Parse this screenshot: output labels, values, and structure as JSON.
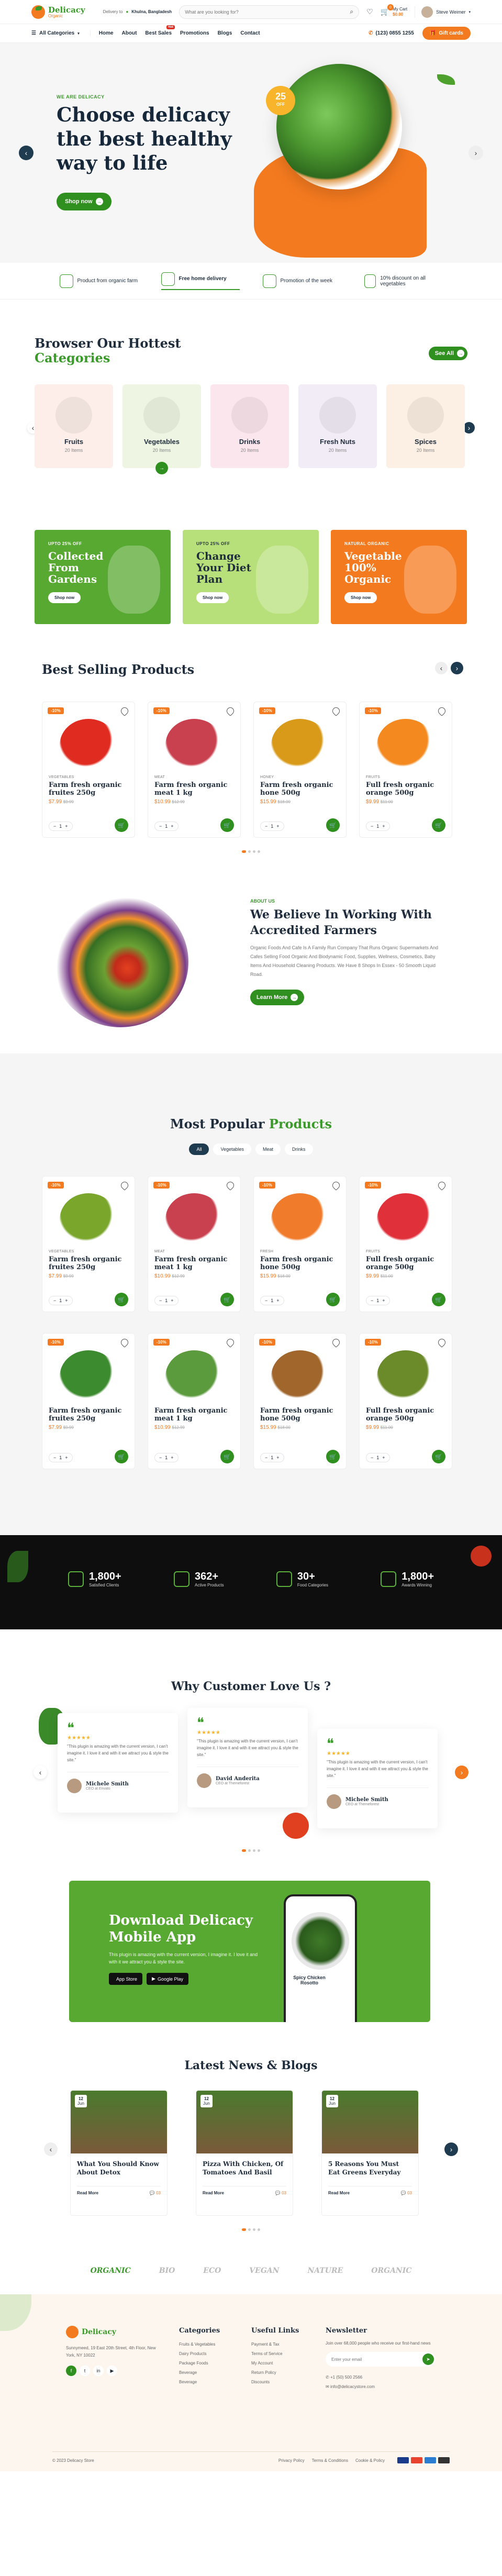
{
  "header": {
    "brand": "Delicacy",
    "brand_sub": "Organic",
    "deliver_label": "Delivery to",
    "location": "Khulna, Bangladesh",
    "search_placeholder": "What are you looking for?",
    "cart_label": "My Cart",
    "cart_amount": "$0.00",
    "cart_count": "0",
    "user": "Steve Weimer",
    "all_categories": "All Categories",
    "nav": [
      "Home",
      "About",
      "Best Sales",
      "Promotions",
      "Blogs",
      "Contact"
    ],
    "hot_badge": "Hot",
    "phone": "(123) 0855 1255",
    "gift_btn": "Gift cards"
  },
  "hero": {
    "kicker": "WE ARE DELICACY",
    "title": "Choose delicacy the best healthy way to life",
    "button": "Shop now",
    "discount_pct": "25",
    "discount_label": "OFF"
  },
  "features": [
    {
      "label": "Product from organic farm"
    },
    {
      "label": "Free home delivery"
    },
    {
      "label": "Promotion of the week"
    },
    {
      "label": "10% discount on all vegetables"
    }
  ],
  "categories": {
    "title_a": "Browser Our Hottest",
    "title_b": "Categories",
    "see_all": "See All",
    "items": [
      {
        "name": "Fruits",
        "count": "20 Items",
        "bg": "#fdeee9"
      },
      {
        "name": "Vegetables",
        "count": "20 Items",
        "bg": "#eef6e3"
      },
      {
        "name": "Drinks",
        "count": "20 Items",
        "bg": "#fce6ee"
      },
      {
        "name": "Fresh Nuts",
        "count": "20 Items",
        "bg": "#f2ecf7"
      },
      {
        "name": "Spices",
        "count": "20 Items",
        "bg": "#fcefe3"
      }
    ]
  },
  "promos": [
    {
      "tag": "UPTO 25% OFF",
      "title": "Collected From Gardens",
      "button": "Shop now",
      "bg": "#57a931"
    },
    {
      "tag": "UPTO 25% OFF",
      "title": "Change Your Diet Plan",
      "button": "Shop now",
      "bg": "#b8e07a"
    },
    {
      "tag": "NATURAL ORGANIC",
      "title": "Vegetable 100% Organic",
      "button": "Shop now",
      "bg": "#f47a1f"
    }
  ],
  "best_selling": {
    "title": "Best Selling Products",
    "items": [
      {
        "cat": "VEGETABLES",
        "name": "Farm fresh organic fruites 250g",
        "price": "$7.99",
        "old": "$9.99",
        "badge": "-10%",
        "qty": "1",
        "color": "#e02b20"
      },
      {
        "cat": "MEAT",
        "name": "Farm fresh organic meat 1 kg",
        "price": "$10.99",
        "old": "$12.99",
        "badge": "-10%",
        "qty": "1",
        "color": "#c9404f"
      },
      {
        "cat": "HONEY",
        "name": "Farm fresh organic hone 500g",
        "price": "$15.99",
        "old": "$18.00",
        "badge": "-10%",
        "qty": "1",
        "color": "#d89a18"
      },
      {
        "cat": "FRUITS",
        "name": "Full fresh organic orange 500g",
        "price": "$9.99",
        "old": "$11.00",
        "badge": "-10%",
        "qty": "1",
        "color": "#f48a1f"
      }
    ]
  },
  "accredited": {
    "kicker": "ABOUT US",
    "title": "We Believe In Working With Accredited Farmers",
    "text": "Organic Foods And Cafe Is A Family Run Company That Runs Organic Supermarkets And Cafes Selling Food Organic And Biodynamic Food, Supplies, Wellness, Cosmetics, Baby Items And Household Cleaning Products. We Have 8 Shops In Essex - 50 Smooth Liquid Road.",
    "button": "Learn More"
  },
  "popular": {
    "title_a": "Most Popular",
    "title_b": "Products",
    "tabs": [
      "All",
      "Vegetables",
      "Meat",
      "Drinks"
    ],
    "items": [
      {
        "cat": "VEGETABLES",
        "name": "Farm fresh organic fruites 250g",
        "price": "$7.99",
        "old": "$9.99",
        "badge": "-10%",
        "qty": "1",
        "color": "#7aa62c"
      },
      {
        "cat": "MEAT",
        "name": "Farm fresh organic meat 1 kg",
        "price": "$10.99",
        "old": "$12.99",
        "badge": "-10%",
        "qty": "1",
        "color": "#c9404f"
      },
      {
        "cat": "FRESH",
        "name": "Farm fresh organic hone 500g",
        "price": "$15.99",
        "old": "$18.00",
        "badge": "-10%",
        "qty": "1",
        "color": "#f07b2a"
      },
      {
        "cat": "FRUITS",
        "name": "Full fresh organic orange 500g",
        "price": "$9.99",
        "old": "$11.00",
        "badge": "-10%",
        "qty": "1",
        "color": "#e0303a"
      },
      {
        "cat": "",
        "name": "Farm fresh organic fruites 250g",
        "price": "$7.99",
        "old": "$9.99",
        "badge": "-10%",
        "qty": "1",
        "color": "#3d8b2f"
      },
      {
        "cat": "",
        "name": "Farm fresh organic meat 1 kg",
        "price": "$10.99",
        "old": "$12.99",
        "badge": "-10%",
        "qty": "1",
        "color": "#5b9b3d"
      },
      {
        "cat": "",
        "name": "Farm fresh organic hone 500g",
        "price": "$15.99",
        "old": "$18.00",
        "badge": "-10%",
        "qty": "1",
        "color": "#a0662c"
      },
      {
        "cat": "",
        "name": "Full fresh organic orange 500g",
        "price": "$9.99",
        "old": "$11.00",
        "badge": "-10%",
        "qty": "1",
        "color": "#6b8a2a"
      }
    ]
  },
  "stats": [
    {
      "value": "1,800+",
      "label": "Satisfied Clients"
    },
    {
      "value": "362+",
      "label": "Active Products"
    },
    {
      "value": "30+",
      "label": "Food Categories"
    },
    {
      "value": "1,800+",
      "label": "Awards Winning"
    }
  ],
  "testimonials": {
    "title": "Why Customer Love Us ?",
    "stars": "★★★★★",
    "items": [
      {
        "text": "\"This plugin is amazing with the current version, I can't imagine it. I love it and with it we attract you & style the site.\"",
        "name": "Michele Smith",
        "role": "CEO at Envato"
      },
      {
        "text": "\"This plugin is amazing with the current version, I can't imagine it. I love it and with it we attract you & style the site.\"",
        "name": "David Anderita",
        "role": "CEO at Themeforest"
      },
      {
        "text": "\"This plugin is amazing with the current version, I can't imagine it. I love it and with it we attract you & style the site.\"",
        "name": "Michele Smith",
        "role": "CEO at Themeforest"
      }
    ]
  },
  "app": {
    "title": "Download Delicacy Mobile App",
    "text": "This plugin is amazing with the current version, I imagine it. I love it and with it we attract you & style the site.",
    "appstore": "App Store",
    "playstore": "Google Play",
    "phone_label": "Spicy Chicken Rosotto"
  },
  "news": {
    "title": "Latest News & Blogs",
    "read_more": "Read More",
    "items": [
      {
        "day": "12",
        "mon": "Jun",
        "title": "What You Should Know About Detox",
        "comments": "03"
      },
      {
        "day": "12",
        "mon": "Jun",
        "title": "Pizza With Chicken, Of Tomatoes And Basil",
        "comments": "03"
      },
      {
        "day": "12",
        "mon": "Jun",
        "title": "5 Reasons You Must Eat Greens Everyday",
        "comments": "03"
      }
    ]
  },
  "brands": [
    "ORGANIC",
    "BIO",
    "ECO",
    "VEGAN",
    "NATURE",
    "ORGANIC"
  ],
  "footer": {
    "about": "Sunnymeed, 19 East 20th Street, 4th Floor, New York, NY 10022",
    "cat_title": "Categories",
    "cats": [
      "Fruits & Vegetables",
      "Dairy Products",
      "Package Foods",
      "Beverage",
      "Beverage"
    ],
    "links_title": "Useful Links",
    "links": [
      "Payment & Tax",
      "Terms of Service",
      "My Account",
      "Return Policy",
      "Discounts"
    ],
    "news_title": "Newsletter",
    "news_text": "Join over 68,000 people who receive our first-hand news",
    "email_placeholder": "Enter your email",
    "phone": "+1 (50) 500 2566",
    "mail": "info@delicacystore.com",
    "copyright": "© 2023 Delicacy Store",
    "bottom_links": [
      "Privacy Policy",
      "Terms & Conditions",
      "Cookie & Policy"
    ]
  }
}
